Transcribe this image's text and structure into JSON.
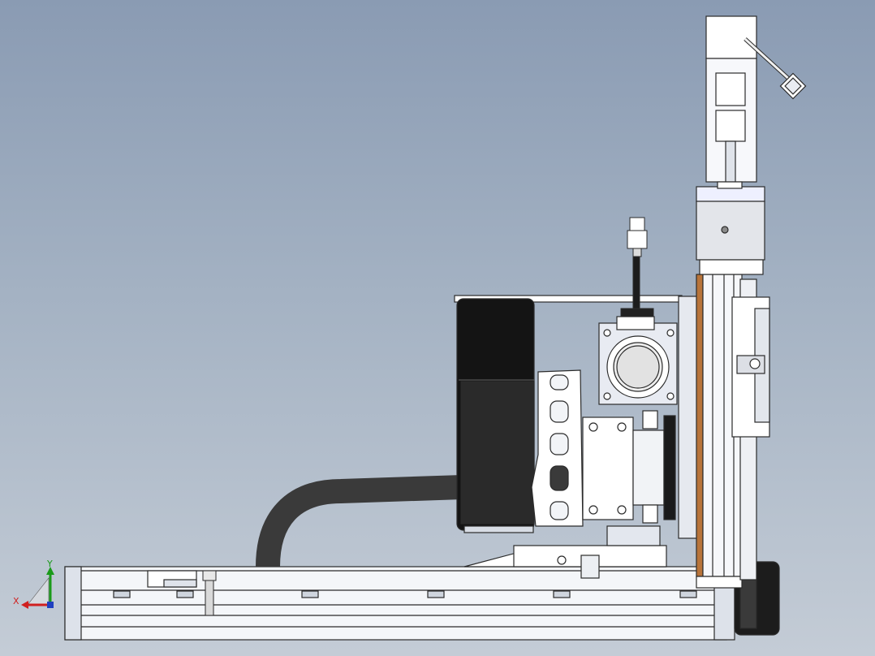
{
  "view": {
    "title": "",
    "triad": {
      "x_label": "X",
      "y_label": "Y",
      "x_color": "#d02020",
      "y_color": "#1a9a1a",
      "z_color": "#2040c0"
    }
  },
  "colors": {
    "background_top": "#8a9bb3",
    "background_bottom": "#c4ccd6",
    "part_fill": "#ffffff",
    "part_shade": "#e6eaf1",
    "line": "#2b2b2b",
    "motor_black": "#161616",
    "cable": "#3a3a3a",
    "copper_strip": "#b8743a"
  },
  "components": [
    "base-rail",
    "vertical-column",
    "vertical-servo-motor",
    "motor-coupling-block",
    "handle-lever",
    "fan-guard",
    "cable-loop",
    "slotted-bracket",
    "servo-motor-round",
    "connector-plug",
    "drive-box",
    "column-carriage",
    "end-motor",
    "bolt"
  ]
}
